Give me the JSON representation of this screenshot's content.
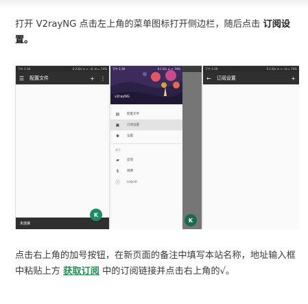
{
  "intro": {
    "text": "打开 V2rayNG 点击左上角的菜单图标打开侧边栏，随后点击 ",
    "bold": "订阅设置。"
  },
  "screens": {
    "profiles": {
      "status_left": "下午 1:36",
      "status_right": "0.2 K/s ⊘ ᯤ .ıll .ıll ▭ 74%",
      "title": "配置文件",
      "menu_icon": "hamburger-icon",
      "add_icon": "plus-icon",
      "more_icon": "more-vert-icon",
      "footer": "未连接",
      "fab_icon": "v-logo-icon"
    },
    "drawer": {
      "status_left": "下午 1:36",
      "status_right": "0.1 K/s ⊘ ᯤ 74%",
      "app_name": "v2rayNG",
      "items": [
        {
          "icon": "file-icon",
          "label": "配置文件",
          "selected": false
        },
        {
          "icon": "subscription-icon",
          "label": "订阅设置",
          "selected": true
        },
        {
          "icon": "gear-icon",
          "label": "设置",
          "selected": false
        }
      ],
      "section": "关于",
      "items2": [
        {
          "icon": "feedback-icon",
          "label": "反馈"
        },
        {
          "icon": "dollar-icon",
          "label": "捐赠"
        },
        {
          "icon": "info-icon",
          "label": "Logcat"
        }
      ]
    },
    "subscription": {
      "status_left": "下午 1:36",
      "status_right": "0.1 K/s ⊘ ᯤ .ıll ▭ 74%",
      "back_icon": "arrow-back-icon",
      "title": "订阅设置",
      "add_icon": "plus-icon"
    }
  },
  "outro": {
    "text1": "点击右上角的加号按钮，在新页面的备注中填写本站名称，地址输入框中粘贴上方 ",
    "link": "获取订阅",
    "text2": " 中的订阅链接并点击右上角的√。"
  }
}
